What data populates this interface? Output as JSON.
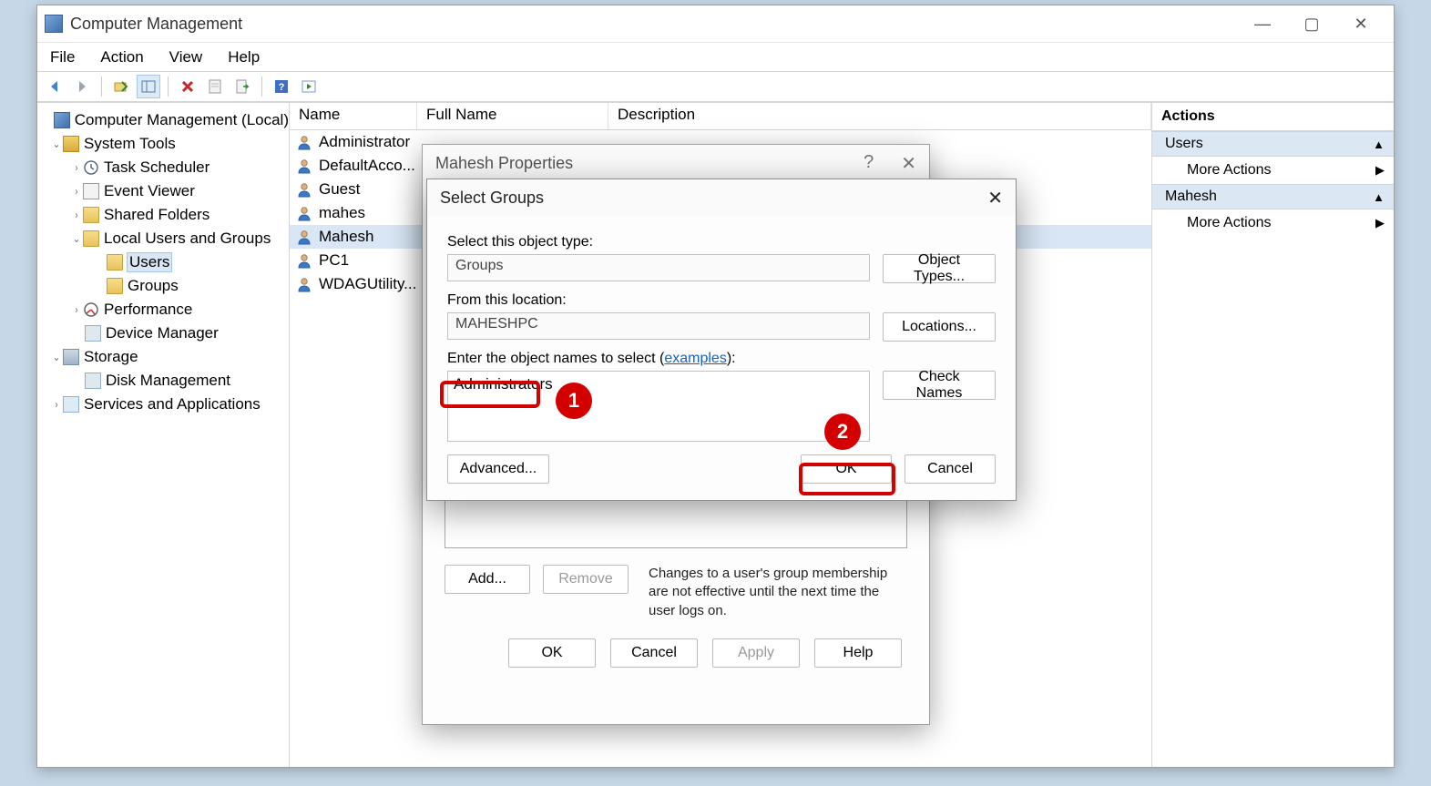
{
  "window": {
    "title": "Computer Management"
  },
  "menu": {
    "file": "File",
    "action": "Action",
    "view": "View",
    "help": "Help"
  },
  "tree": {
    "root": "Computer Management (Local)",
    "system_tools": "System Tools",
    "task_scheduler": "Task Scheduler",
    "event_viewer": "Event Viewer",
    "shared_folders": "Shared Folders",
    "local_users_groups": "Local Users and Groups",
    "users": "Users",
    "groups": "Groups",
    "performance": "Performance",
    "device_manager": "Device Manager",
    "storage": "Storage",
    "disk_management": "Disk Management",
    "services_apps": "Services and Applications"
  },
  "columns": {
    "name": "Name",
    "full_name": "Full Name",
    "description": "Description"
  },
  "users_list": [
    "Administrator",
    "DefaultAcco...",
    "Guest",
    "mahes",
    "Mahesh",
    "PC1",
    "WDAGUtility..."
  ],
  "selected_user_index": 4,
  "actions": {
    "title": "Actions",
    "users": "Users",
    "mahesh": "Mahesh",
    "more": "More Actions"
  },
  "props": {
    "title": "Mahesh Properties",
    "add": "Add...",
    "remove": "Remove",
    "note": "Changes to a user's group membership are not effective until the next time the user logs on.",
    "ok": "OK",
    "cancel": "Cancel",
    "apply": "Apply",
    "help": "Help"
  },
  "sg": {
    "title": "Select Groups",
    "object_type_label": "Select this object type:",
    "object_type_value": "Groups",
    "object_types_btn": "Object Types...",
    "location_label": "From this location:",
    "location_value": "MAHESHPC",
    "locations_btn": "Locations...",
    "names_label_prefix": "Enter the object names to select (",
    "names_label_link": "examples",
    "names_label_suffix": "):",
    "names_value": "Administrators",
    "check_names": "Check Names",
    "advanced": "Advanced...",
    "ok": "OK",
    "cancel": "Cancel"
  },
  "annotations": {
    "step1": "1",
    "step2": "2"
  }
}
